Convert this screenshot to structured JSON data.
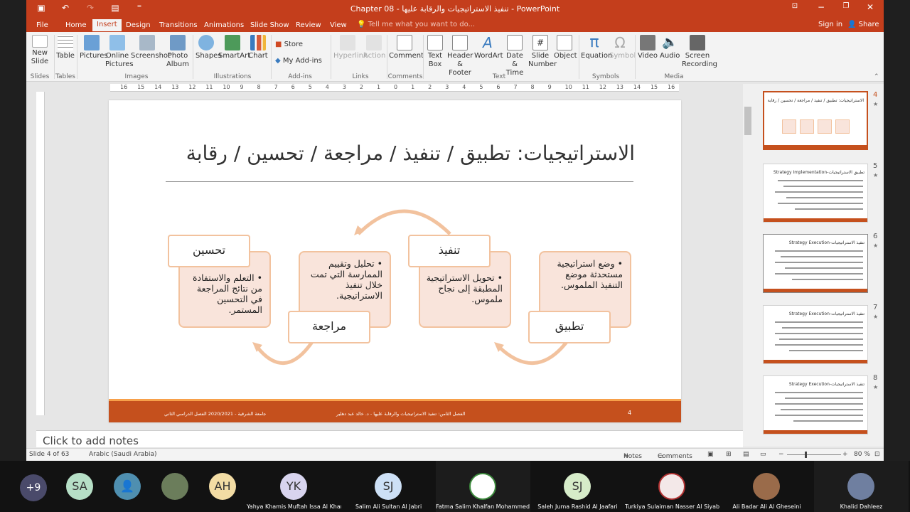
{
  "window": {
    "title": "Chapter 08 - تنفيذ الاستراتيجيات والرقابة عليها - PowerPoint",
    "qa_icons": [
      "save-icon",
      "undo-icon",
      "redo-icon",
      "present-icon",
      "customize-icon"
    ],
    "controls": [
      "ribbon-display-icon",
      "minimize-icon",
      "restore-icon",
      "close-icon"
    ]
  },
  "tabs": {
    "items": [
      "File",
      "Home",
      "Insert",
      "Design",
      "Transitions",
      "Animations",
      "Slide Show",
      "Review",
      "View"
    ],
    "active": "Insert",
    "tell_me": "Tell me what you want to do...",
    "signin": "Sign in",
    "share": "Share"
  },
  "ribbon": {
    "new_slide": "New Slide",
    "table": "Table",
    "pictures": "Pictures",
    "online_pictures": "Online Pictures",
    "screenshot": "Screenshot",
    "photo_album": "Photo Album",
    "shapes": "Shapes",
    "smartart": "SmartArt",
    "chart": "Chart",
    "store": "Store",
    "my_addins": "My Add-ins",
    "hyperlink": "Hyperlink",
    "action": "Action",
    "comment": "Comment",
    "text_box": "Text Box",
    "header_footer": "Header & Footer",
    "wordart": "WordArt",
    "date_time": "Date & Time",
    "slide_number": "Slide Number",
    "object": "Object",
    "equation": "Equation",
    "symbol": "Symbol",
    "video": "Video",
    "audio": "Audio",
    "screen_recording": "Screen Recording",
    "groups": {
      "slides": "Slides",
      "tables": "Tables",
      "images": "Images",
      "illustrations": "Illustrations",
      "addins": "Add-ins",
      "links": "Links",
      "comments": "Comments",
      "text": "Text",
      "symbols": "Symbols",
      "media": "Media"
    }
  },
  "ruler": {
    "labels": [
      "16",
      "15",
      "14",
      "13",
      "12",
      "11",
      "10",
      "9",
      "8",
      "7",
      "6",
      "5",
      "4",
      "3",
      "2",
      "1",
      "0",
      "1",
      "2",
      "3",
      "4",
      "5",
      "6",
      "7",
      "8",
      "9",
      "10",
      "11",
      "12",
      "13",
      "14",
      "15",
      "16"
    ]
  },
  "slide": {
    "title": "الاستراتيجيات: تطبيق / تنفيذ / مراجعة / تحسين / رقابة",
    "steps": [
      {
        "head": "تطبيق",
        "body": "وضع استراتيجية مستحدثة موضع التنفيذ الملموس."
      },
      {
        "head": "تنفيذ",
        "body": "تحويل الاستراتيجية المطبقة إلى نجاح ملموس."
      },
      {
        "head": "مراجعة",
        "body": "تحليل وتقييم الممارسة التي تمت خلال تنفيذ الاستراتيجية."
      },
      {
        "head": "تحسين",
        "body": "التعلم والاستفادة من نتائج المراجعة في التحسين المستمر."
      }
    ],
    "footer": {
      "left": "جامعة الشرقية - 2020/2021 الفصل الدراسي الثاني",
      "center": "الفصل الثامن: تنفيذ الاستراتيجيات والرقابة عليها - د. خالد عبد دهلير",
      "page": "4"
    },
    "colors": {
      "accent": "#c5501d",
      "box_fill": "#f9e4db",
      "box_border": "#f2c29e",
      "arrow": "#f2c29e"
    }
  },
  "notes": {
    "placeholder": "Click to add notes"
  },
  "thumbnails": [
    {
      "num": "4",
      "title": "الاستراتيجيات: تطبيق / تنفيذ / مراجعة / تحسين / رقابة",
      "selected": true
    },
    {
      "num": "5",
      "title": "Strategy Implementation-تطبيق الاستراتيجيات"
    },
    {
      "num": "6",
      "title": "Strategy Execution-تنفيذ الاستراتيجيات"
    },
    {
      "num": "7",
      "title": "Strategy Execution-تنفيذ الاستراتيجيات"
    },
    {
      "num": "8",
      "title": "Strategy Execution-تنفيذ الاستراتيجيات"
    }
  ],
  "status": {
    "slide": "Slide 4 of 63",
    "language": "Arabic (Saudi Arabia)",
    "notes": "Notes",
    "comments": "Comments",
    "zoom": "80 %"
  },
  "meeting": {
    "more": "+9",
    "avatars": [
      "SA",
      "",
      "",
      "AH"
    ],
    "participants": [
      {
        "initials": "YK",
        "name": "Yahya Khamis Muftah Issa Al Kharusi"
      },
      {
        "initials": "SJ",
        "name": "Salim Ali Sultan Al Jabri"
      },
      {
        "initials": "",
        "name": "Fatma Salim Khalfan Mohammed Al..."
      },
      {
        "initials": "SJ",
        "name": "Saleh Juma Rashid Al Jaafari"
      },
      {
        "initials": "",
        "name": "Turkiya Sulaiman Nasser Al Siyabi"
      },
      {
        "initials": "",
        "name": "Ali Badar Ali Al Gheseini"
      },
      {
        "initials": "",
        "name": "Khalid Dahleez"
      }
    ]
  }
}
